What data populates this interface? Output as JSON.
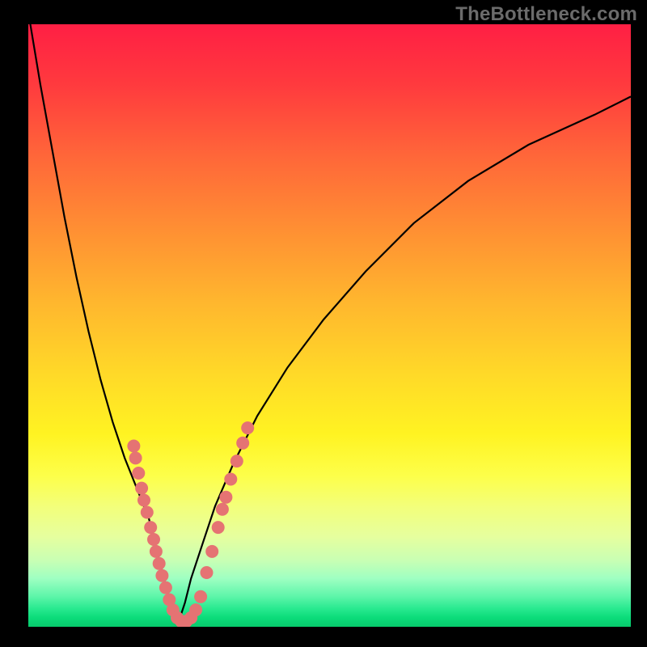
{
  "watermark": "TheBottleneck.com",
  "colors": {
    "scatter_fill": "#e57373",
    "curve_stroke": "#000000",
    "frame_bg": "#000000"
  },
  "chart_data": {
    "type": "line",
    "title": "",
    "xlabel": "",
    "ylabel": "",
    "xlim": [
      0,
      100
    ],
    "ylim": [
      0,
      100
    ],
    "grid": false,
    "series": [
      {
        "name": "left-branch",
        "x": [
          0,
          2,
          4,
          6,
          8,
          10,
          12,
          14,
          16,
          18,
          20,
          21,
          22,
          23,
          24,
          25
        ],
        "y": [
          102,
          90,
          79,
          68,
          58,
          49,
          41,
          34,
          28,
          23,
          18,
          14,
          10,
          6,
          3,
          1
        ]
      },
      {
        "name": "right-branch",
        "x": [
          25,
          26,
          27,
          29,
          31,
          34,
          38,
          43,
          49,
          56,
          64,
          73,
          83,
          94,
          100
        ],
        "y": [
          1,
          4,
          8,
          14,
          20,
          27,
          35,
          43,
          51,
          59,
          67,
          74,
          80,
          85,
          88
        ]
      }
    ],
    "scatter": {
      "name": "benchmark-points",
      "points": [
        {
          "x": 17.5,
          "y": 30.0
        },
        {
          "x": 17.8,
          "y": 28.0
        },
        {
          "x": 18.3,
          "y": 25.5
        },
        {
          "x": 18.8,
          "y": 23.0
        },
        {
          "x": 19.2,
          "y": 21.0
        },
        {
          "x": 19.7,
          "y": 19.0
        },
        {
          "x": 20.3,
          "y": 16.5
        },
        {
          "x": 20.8,
          "y": 14.5
        },
        {
          "x": 21.2,
          "y": 12.5
        },
        {
          "x": 21.7,
          "y": 10.5
        },
        {
          "x": 22.2,
          "y": 8.5
        },
        {
          "x": 22.8,
          "y": 6.5
        },
        {
          "x": 23.4,
          "y": 4.5
        },
        {
          "x": 24.0,
          "y": 2.8
        },
        {
          "x": 24.7,
          "y": 1.5
        },
        {
          "x": 25.4,
          "y": 0.9
        },
        {
          "x": 26.2,
          "y": 0.9
        },
        {
          "x": 27.0,
          "y": 1.5
        },
        {
          "x": 27.8,
          "y": 2.8
        },
        {
          "x": 28.6,
          "y": 5.0
        },
        {
          "x": 29.6,
          "y": 9.0
        },
        {
          "x": 30.5,
          "y": 12.5
        },
        {
          "x": 31.5,
          "y": 16.5
        },
        {
          "x": 32.2,
          "y": 19.5
        },
        {
          "x": 32.8,
          "y": 21.5
        },
        {
          "x": 33.6,
          "y": 24.5
        },
        {
          "x": 34.6,
          "y": 27.5
        },
        {
          "x": 35.6,
          "y": 30.5
        },
        {
          "x": 36.4,
          "y": 33.0
        }
      ]
    }
  }
}
